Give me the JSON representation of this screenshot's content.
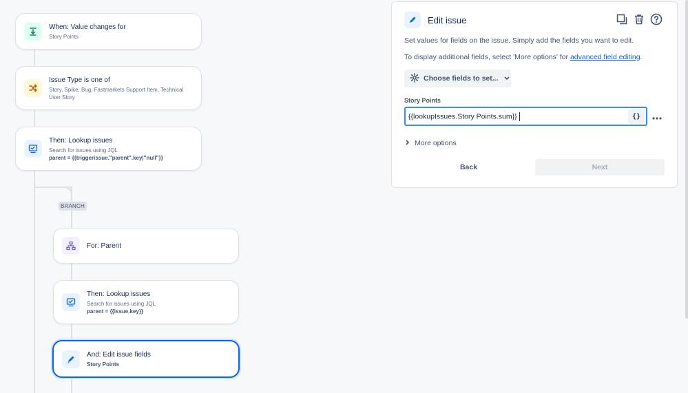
{
  "flow": {
    "trigger": {
      "title": "When: Value changes for",
      "sub": "Story Points",
      "icon": "value-change-icon"
    },
    "condition": {
      "title": "Issue Type is one of",
      "sub": "Story, Spike, Bug, Fastmarkets Support Item, Technical User Story",
      "icon": "shuffle-icon"
    },
    "lookup1": {
      "title": "Then: Lookup issues",
      "sub": "Search for issues using JQL",
      "query": "parent = {{triggerissue.\"parent\".key|\"null\"}}",
      "icon": "lookup-icon"
    },
    "branch_label": "BRANCH",
    "for_parent": {
      "title": "For: Parent",
      "icon": "hierarchy-icon"
    },
    "lookup2": {
      "title": "Then: Lookup issues",
      "sub": "Search for issues using JQL",
      "query": "parent = {{issue.key}}",
      "icon": "lookup-icon"
    },
    "edit": {
      "title": "And: Edit issue fields",
      "sub": "Story Points",
      "icon": "pencil-icon"
    }
  },
  "panel": {
    "title": "Edit issue",
    "desc1": "Set values for fields on the issue. Simply add the fields you want to edit.",
    "desc2_prefix": "To display additional fields, select 'More options' for ",
    "desc2_link": "advanced field editing",
    "desc2_suffix": ".",
    "choose_button": "Choose fields to set...",
    "field_label": "Story Points",
    "field_value": "{{lookupIssues.Story Points.sum}}",
    "smart_values_button": "{}",
    "more_options": "More options",
    "back_button": "Back",
    "next_button": "Next",
    "icons": [
      "pencil-icon",
      "duplicate-icon",
      "trash-icon",
      "help-icon"
    ]
  },
  "colors": {
    "accent": "#0c66e4",
    "focus_border": "#388bff",
    "background": "#f7f8f9"
  }
}
